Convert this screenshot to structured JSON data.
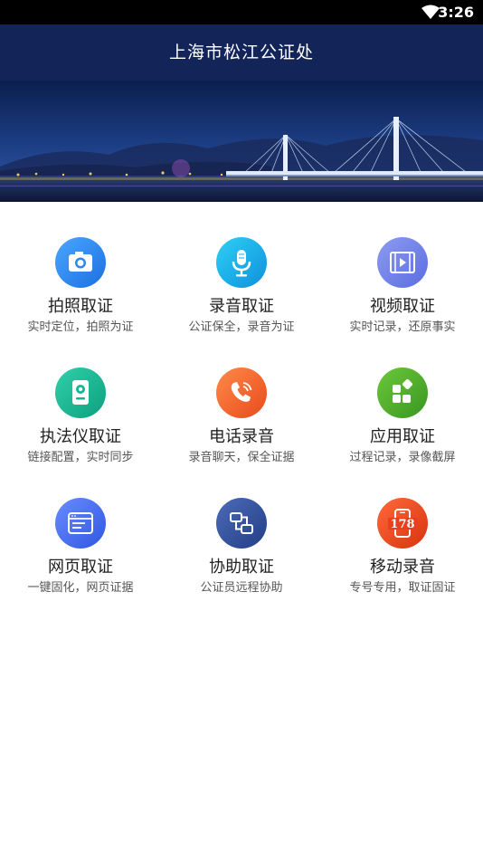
{
  "status_bar": {
    "time": "3:26",
    "wifi_icon": "wifi-icon"
  },
  "header": {
    "title": "上海市松江公证处"
  },
  "banner": {
    "image": "bridge-night-banner"
  },
  "services": [
    {
      "name": "拍照取证",
      "desc": "实时定位，拍照为证",
      "icon": "camera-icon",
      "color": "#2E86F0"
    },
    {
      "name": "录音取证",
      "desc": "公证保全，录音为证",
      "icon": "microphone-icon",
      "color": "#14A9E8"
    },
    {
      "name": "视频取证",
      "desc": "实时记录，还原事实",
      "icon": "video-film-icon",
      "color": "#6B7FE6"
    },
    {
      "name": "执法仪取证",
      "desc": "链接配置，实时同步",
      "icon": "body-camera-icon",
      "color": "#15B594"
    },
    {
      "name": "电话录音",
      "desc": "录音聊天，保全证据",
      "icon": "phone-call-icon",
      "color": "#F2622C"
    },
    {
      "name": "应用取证",
      "desc": "过程记录，录像截屏",
      "icon": "app-grid-icon",
      "color": "#4DAE2C"
    },
    {
      "name": "网页取证",
      "desc": "一键固化，网页证据",
      "icon": "browser-window-icon",
      "color": "#3F6BE8"
    },
    {
      "name": "协助取证",
      "desc": "公证员远程协助",
      "icon": "remote-assist-icon",
      "color": "#2F4E9C"
    },
    {
      "name": "移动录音",
      "desc": "专号专用，取证固证",
      "icon": "mobile-178-icon",
      "color": "#E8401E",
      "badge": "178"
    }
  ]
}
